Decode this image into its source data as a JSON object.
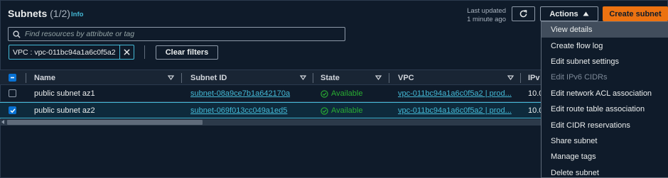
{
  "header": {
    "title": "Subnets",
    "count": "(1/2)",
    "info": "Info",
    "last_updated_line1": "Last updated",
    "last_updated_line2": "1 minute ago",
    "actions_label": "Actions",
    "create_label": "Create subnet"
  },
  "search": {
    "placeholder": "Find resources by attribute or tag",
    "value": ""
  },
  "filter_token": {
    "label": "VPC : vpc-011bc94a1a6c0f5a2"
  },
  "clear_filters_label": "Clear filters",
  "table": {
    "columns": [
      "Name",
      "Subnet ID",
      "State",
      "VPC",
      "IPv"
    ],
    "rows": [
      {
        "selected": false,
        "name": "public subnet az1",
        "subnet_id": "subnet-08a9ce7b1a642170a",
        "state": "Available",
        "vpc": "vpc-011bc94a1a6c0f5a2 | prod...",
        "ipv4": "10.0"
      },
      {
        "selected": true,
        "name": "public subnet az2",
        "subnet_id": "subnet-069f013cc049a1ed5",
        "state": "Available",
        "vpc": "vpc-011bc94a1a6c0f5a2 | prod...",
        "ipv4": "10.0"
      }
    ]
  },
  "actions_menu": {
    "items": [
      {
        "label": "View details",
        "state": "highlighted"
      },
      {
        "label": "Create flow log",
        "state": "enabled"
      },
      {
        "label": "Edit subnet settings",
        "state": "enabled"
      },
      {
        "label": "Edit IPv6 CIDRs",
        "state": "disabled"
      },
      {
        "label": "Edit network ACL association",
        "state": "enabled"
      },
      {
        "label": "Edit route table association",
        "state": "enabled"
      },
      {
        "label": "Edit CIDR reservations",
        "state": "enabled"
      },
      {
        "label": "Share subnet",
        "state": "enabled"
      },
      {
        "label": "Manage tags",
        "state": "enabled"
      },
      {
        "label": "Delete subnet",
        "state": "enabled"
      }
    ]
  },
  "colors": {
    "background": "#0f1b2a",
    "accent_link": "#44b9d6",
    "primary_button": "#ec7211",
    "available": "#29ad32",
    "checkbox_selected": "#0972d3"
  }
}
